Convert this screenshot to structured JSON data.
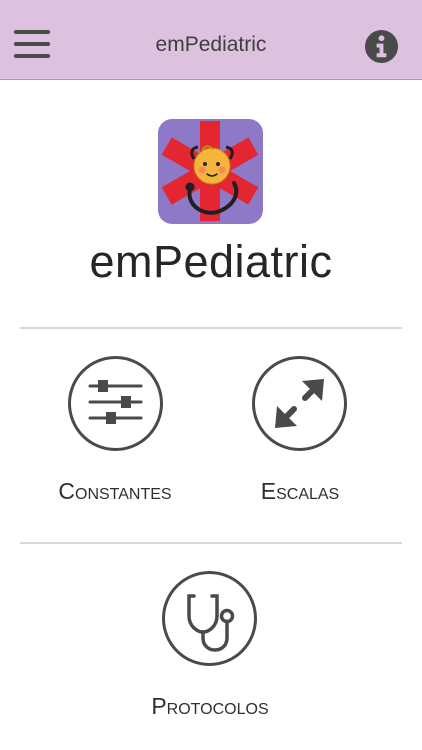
{
  "header": {
    "title": "emPediatric",
    "menu_icon": "hamburger-menu-icon",
    "info_icon": "info-circle-icon"
  },
  "app": {
    "name": "emPediatric",
    "logo": "baby-star-of-life-stethoscope-logo"
  },
  "menu": {
    "constantes": {
      "label": "Constantes",
      "icon": "sliders-icon"
    },
    "escalas": {
      "label": "Escalas",
      "icon": "diagonal-arrows-icon"
    },
    "protocolos": {
      "label": "Protocolos",
      "icon": "stethoscope-icon"
    }
  },
  "colors": {
    "header_bg": "#dcc2de",
    "logo_bg": "#8d79c7",
    "star_red": "#e3262f",
    "icon_gray": "#4a4a4a"
  }
}
